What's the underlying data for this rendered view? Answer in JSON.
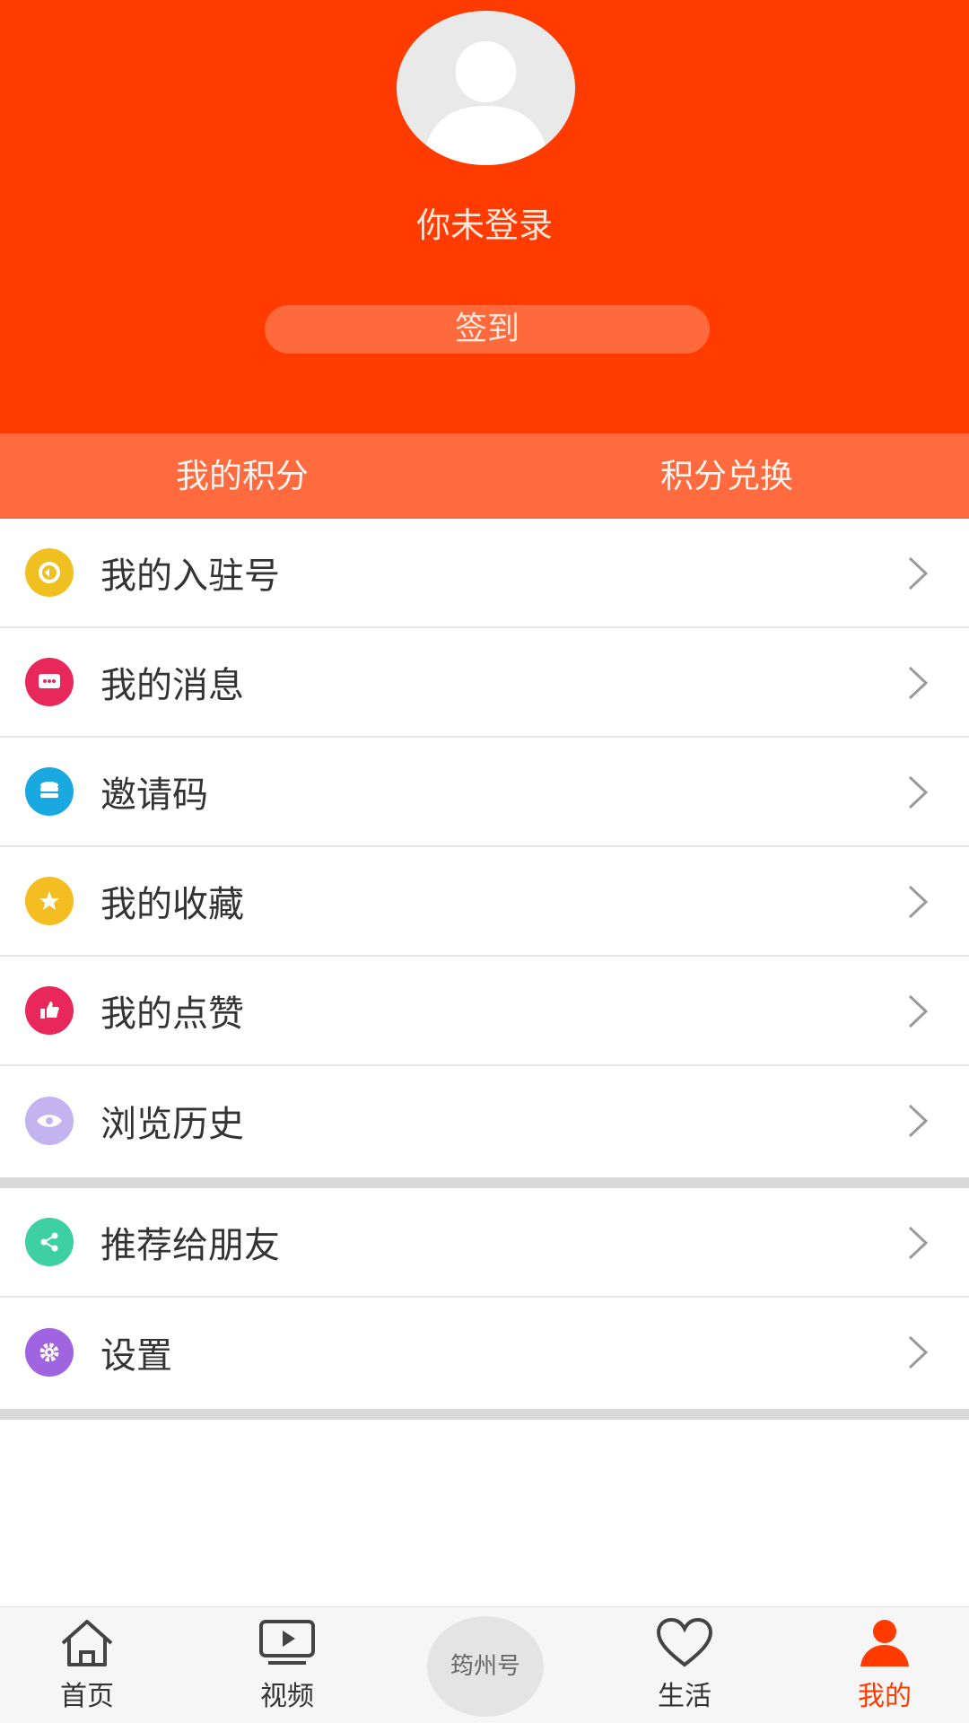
{
  "header": {
    "login_status": "你未登录",
    "signin_label": "签到"
  },
  "points": {
    "my_points": "我的积分",
    "exchange": "积分兑换"
  },
  "menu_group1": [
    {
      "label": "我的入驻号",
      "icon": "account-swap-icon",
      "color": "#f0c021"
    },
    {
      "label": "我的消息",
      "icon": "message-icon",
      "color": "#e8275a"
    },
    {
      "label": "邀请码",
      "icon": "database-icon",
      "color": "#1aa8e0"
    },
    {
      "label": "我的收藏",
      "icon": "star-icon",
      "color": "#f4be22"
    },
    {
      "label": "我的点赞",
      "icon": "thumbs-up-icon",
      "color": "#e8275a"
    },
    {
      "label": "浏览历史",
      "icon": "eye-icon",
      "color": "#c3b4f0"
    }
  ],
  "menu_group2": [
    {
      "label": "推荐给朋友",
      "icon": "share-icon",
      "color": "#3ecfa3"
    },
    {
      "label": "设置",
      "icon": "gear-icon",
      "color": "#a064e0"
    }
  ],
  "tabs": {
    "home": "首页",
    "video": "视频",
    "center": "筠州号",
    "life": "生活",
    "mine": "我的"
  },
  "colors": {
    "brand": "#ff3b00",
    "points_bar": "#ff6a3f",
    "active_tab": "#ff3b00"
  }
}
